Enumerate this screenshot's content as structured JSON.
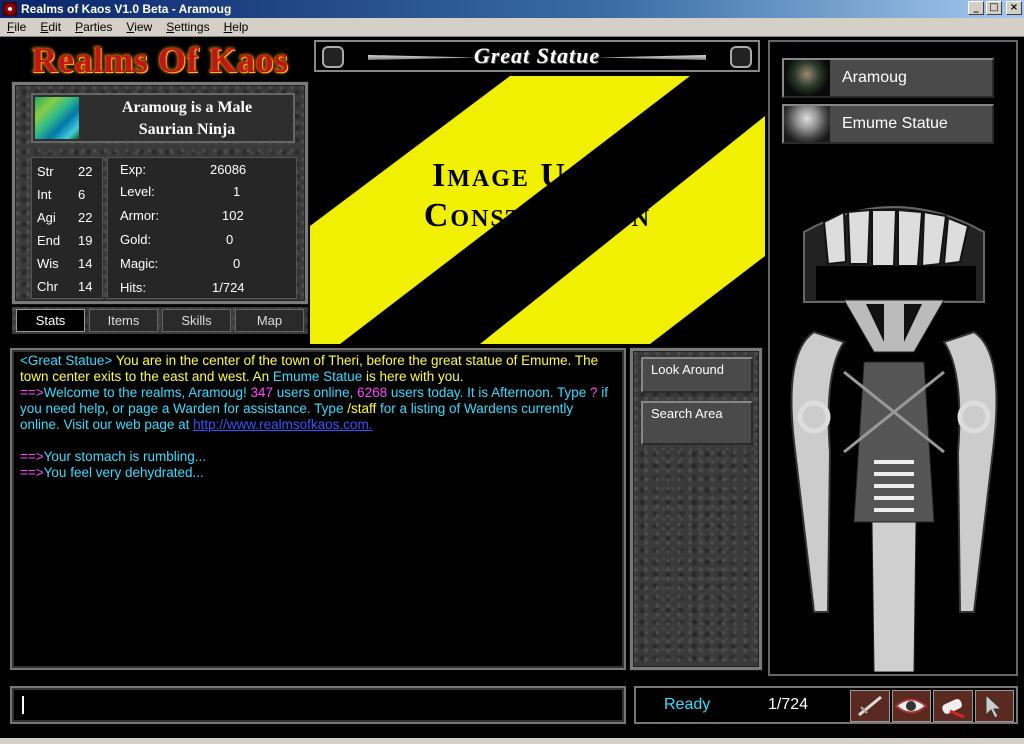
{
  "window": {
    "title": "Realms of Kaos V1.0 Beta - Aramoug"
  },
  "menu": [
    "File",
    "Edit",
    "Parties",
    "View",
    "Settings",
    "Help"
  ],
  "logo": "Realms Of Kaos",
  "character": {
    "desc_line1": "Aramoug is a Male",
    "desc_line2": "Saurian Ninja",
    "stats": [
      {
        "label": "Str",
        "value": "22"
      },
      {
        "label": "Int",
        "value": "6"
      },
      {
        "label": "Agi",
        "value": "22"
      },
      {
        "label": "End",
        "value": "19"
      },
      {
        "label": "Wis",
        "value": "14"
      },
      {
        "label": "Chr",
        "value": "14"
      }
    ],
    "info": [
      {
        "label": "Exp:",
        "value": "26086"
      },
      {
        "label": "Level:",
        "value": "1"
      },
      {
        "label": "Armor:",
        "value": "102"
      },
      {
        "label": "Gold:",
        "value": "0"
      },
      {
        "label": "Magic:",
        "value": "0"
      },
      {
        "label": "Hits:",
        "value": "1/724"
      }
    ]
  },
  "tabs": [
    "Stats",
    "Items",
    "Skills",
    "Map"
  ],
  "room": {
    "name": "Great Statue",
    "image_line1": "Image Under",
    "image_line2": "Construction"
  },
  "chat": {
    "l1_a": "<Great Statue>",
    "l1_b": " You are in the center of the town of Theri, before the great statue of Emume. The town center exits to the east and west. An ",
    "l1_c": "Emume Statue",
    "l1_d": " is here with you.",
    "arrow": "==>",
    "l2_a": "Welcome to the realms, Aramoug! ",
    "l2_n1": " 347 ",
    "l2_b": " users online, ",
    "l2_n2": " 6268 ",
    "l2_c": " users today. It is Afternoon. Type ",
    "l2_q": "?",
    "l2_d": " if you need help, or page a Warden for assistance. Type ",
    "l2_s": "/staff",
    "l2_e": " for a listing of Wardens currently online. Visit our web page at ",
    "link": "http://www.realmsofkaos.com.",
    "l3": "Your stomach is rumbling...",
    "l4": "You feel very dehydrated..."
  },
  "actions": [
    "Look Around",
    "Search Area"
  ],
  "entities": [
    "Aramoug",
    "Emume Statue"
  ],
  "status": {
    "ready": "Ready",
    "hits": "1/724"
  },
  "colors": {
    "chat_yellow": "#ffff33",
    "chat_cyan": "#33ddff",
    "chat_magenta": "#ff44ff",
    "logo_red": "#c0151a"
  },
  "icons": [
    "sword-cursor-icon",
    "eye-cursor-icon",
    "scroll-cursor-icon",
    "pointer-cursor-icon"
  ]
}
